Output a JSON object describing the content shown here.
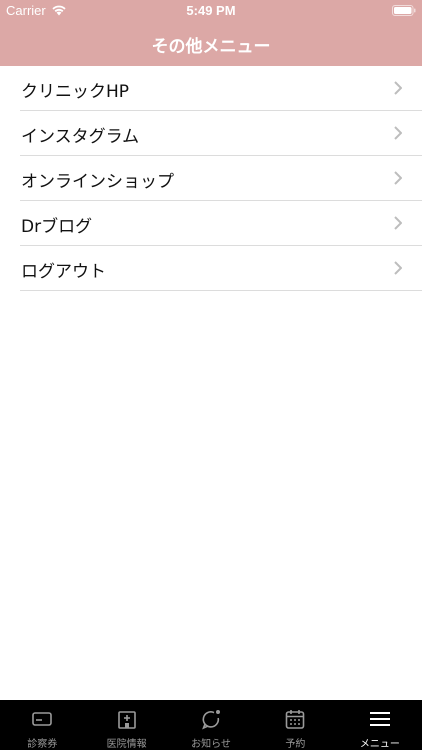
{
  "status_bar": {
    "carrier": "Carrier",
    "time": "5:49 PM"
  },
  "header": {
    "title": "その他メニュー",
    "background": "#dca8a6"
  },
  "menu": {
    "items": [
      {
        "label": "クリニックHP"
      },
      {
        "label": "インスタグラム"
      },
      {
        "label": "オンラインショップ"
      },
      {
        "label": "Drブログ"
      },
      {
        "label": "ログアウト"
      }
    ]
  },
  "tab_bar": {
    "tabs": [
      {
        "label": "診察券",
        "icon": "card-icon",
        "active": false
      },
      {
        "label": "医院情報",
        "icon": "hospital-icon",
        "active": false
      },
      {
        "label": "お知らせ",
        "icon": "notification-icon",
        "active": false
      },
      {
        "label": "予約",
        "icon": "calendar-icon",
        "active": false
      },
      {
        "label": "メニュー",
        "icon": "hamburger-icon",
        "active": true
      }
    ]
  }
}
